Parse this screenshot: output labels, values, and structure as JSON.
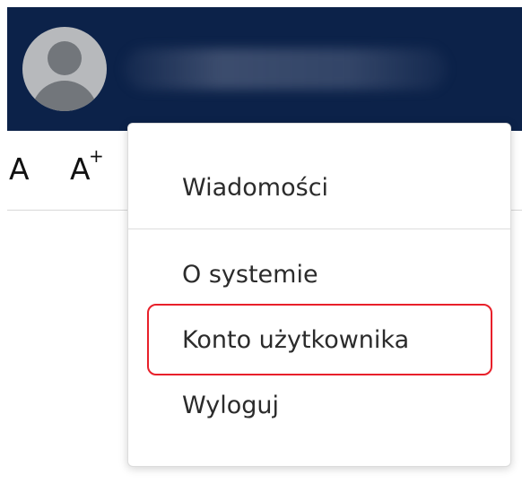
{
  "header": {
    "avatar_icon": "user-avatar-icon",
    "user_name_redacted": true
  },
  "toolbar": {
    "font_decrease_label": "A",
    "font_increase_label": "A",
    "font_increase_sup": "+"
  },
  "menu": {
    "items": [
      {
        "label": "Wiadomości"
      },
      {
        "label": "O systemie"
      },
      {
        "label": "Konto użytkownika",
        "highlighted": true
      },
      {
        "label": "Wyloguj"
      }
    ]
  },
  "colors": {
    "header_bg": "#0c2249",
    "highlight": "#e8202a",
    "text": "#2b2b2b"
  }
}
